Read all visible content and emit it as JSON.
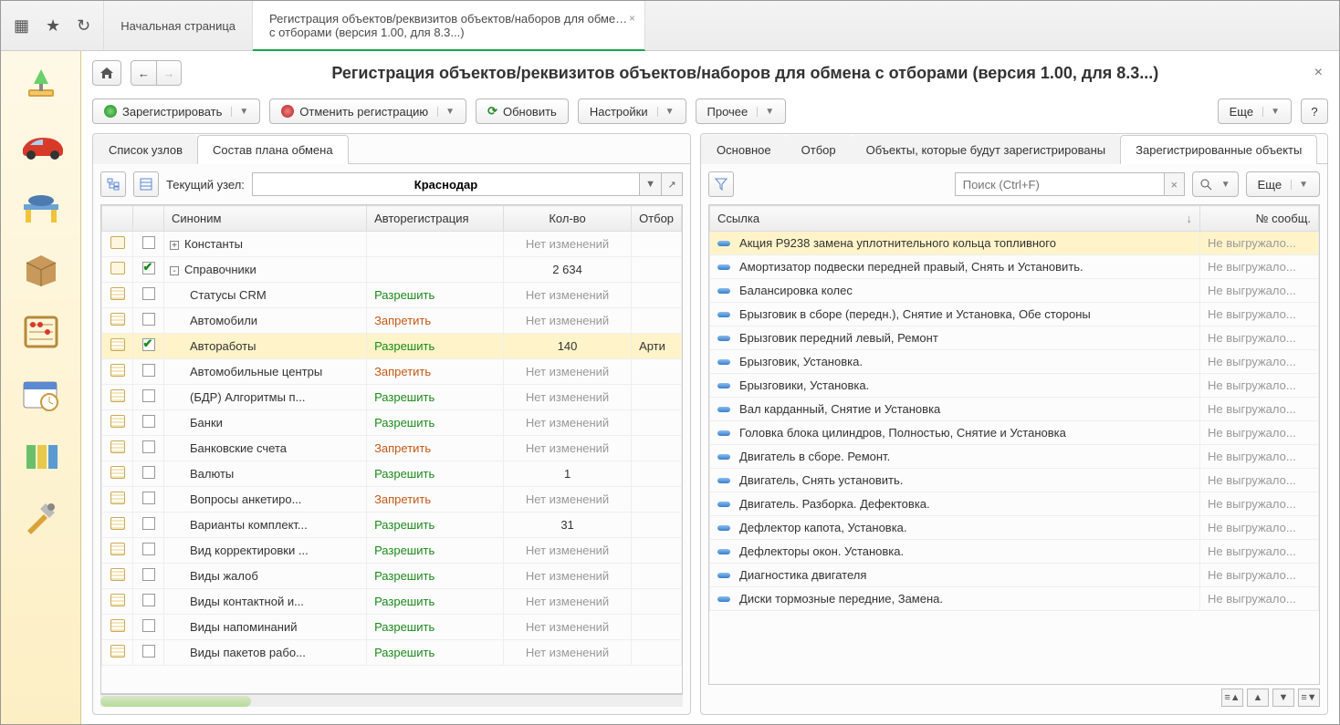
{
  "topbar": {
    "home_tab": "Начальная страница",
    "active_tab_line1": "Регистрация объектов/реквизитов объектов/наборов для обмена",
    "active_tab_line2": "с отборами (версия 1.00, для 8.3...)"
  },
  "header": {
    "title": "Регистрация объектов/реквизитов объектов/наборов для обмена с отборами (версия 1.00, для 8.3...)"
  },
  "toolbar": {
    "register": "Зарегистрировать",
    "unregister": "Отменить регистрацию",
    "refresh": "Обновить",
    "settings": "Настройки",
    "other": "Прочее",
    "more": "Еще",
    "help": "?"
  },
  "left": {
    "tabs": [
      "Список узлов",
      "Состав плана обмена"
    ],
    "active_tab": 1,
    "current_node_label": "Текущий узел:",
    "current_node_value": "Краснодар",
    "columns": {
      "synonym": "Синоним",
      "autoreg": "Авторегистрация",
      "count": "Кол-во",
      "filter": "Отбор"
    },
    "rows": [
      {
        "kind": "group",
        "checked": false,
        "toggle": "+",
        "name": "Константы",
        "auto": "",
        "count": "Нет изменений",
        "count_muted": true
      },
      {
        "kind": "group",
        "checked": true,
        "toggle": "-",
        "name": "Справочники",
        "auto": "",
        "count": "2 634"
      },
      {
        "kind": "item",
        "checked": false,
        "indent": 1,
        "name": "Статусы CRM",
        "auto": "Разрешить",
        "count": "Нет изменений",
        "count_muted": true
      },
      {
        "kind": "item",
        "checked": false,
        "indent": 1,
        "name": "Автомобили",
        "auto": "Запретить",
        "count": "Нет изменений",
        "count_muted": true
      },
      {
        "kind": "item",
        "checked": true,
        "indent": 1,
        "name": "Автоработы",
        "auto": "Разрешить",
        "count": "140",
        "filter": "Арти",
        "selected": true
      },
      {
        "kind": "item",
        "checked": false,
        "indent": 1,
        "name": "Автомобильные центры",
        "auto": "Запретить",
        "count": "Нет изменений",
        "count_muted": true
      },
      {
        "kind": "item",
        "checked": false,
        "indent": 1,
        "name": "(БДР) Алгоритмы п...",
        "auto": "Разрешить",
        "count": "Нет изменений",
        "count_muted": true
      },
      {
        "kind": "item",
        "checked": false,
        "indent": 1,
        "name": "Банки",
        "auto": "Разрешить",
        "count": "Нет изменений",
        "count_muted": true
      },
      {
        "kind": "item",
        "checked": false,
        "indent": 1,
        "name": "Банковские счета",
        "auto": "Запретить",
        "count": "Нет изменений",
        "count_muted": true
      },
      {
        "kind": "item",
        "checked": false,
        "indent": 1,
        "name": "Валюты",
        "auto": "Разрешить",
        "count": "1"
      },
      {
        "kind": "item",
        "checked": false,
        "indent": 1,
        "name": "Вопросы анкетиро...",
        "auto": "Запретить",
        "count": "Нет изменений",
        "count_muted": true
      },
      {
        "kind": "item",
        "checked": false,
        "indent": 1,
        "name": "Варианты комплект...",
        "auto": "Разрешить",
        "count": "31"
      },
      {
        "kind": "item",
        "checked": false,
        "indent": 1,
        "name": "Вид корректировки ...",
        "auto": "Разрешить",
        "count": "Нет изменений",
        "count_muted": true
      },
      {
        "kind": "item",
        "checked": false,
        "indent": 1,
        "name": "Виды жалоб",
        "auto": "Разрешить",
        "count": "Нет изменений",
        "count_muted": true
      },
      {
        "kind": "item",
        "checked": false,
        "indent": 1,
        "name": "Виды контактной и...",
        "auto": "Разрешить",
        "count": "Нет изменений",
        "count_muted": true
      },
      {
        "kind": "item",
        "checked": false,
        "indent": 1,
        "name": "Виды напоминаний",
        "auto": "Разрешить",
        "count": "Нет изменений",
        "count_muted": true
      },
      {
        "kind": "item",
        "checked": false,
        "indent": 1,
        "name": "Виды пакетов рабо...",
        "auto": "Разрешить",
        "count": "Нет изменений",
        "count_muted": true
      }
    ]
  },
  "right": {
    "tabs": [
      "Основное",
      "Отбор",
      "Объекты, которые будут зарегистрированы",
      "Зарегистрированные объекты"
    ],
    "active_tab": 3,
    "search_placeholder": "Поиск (Ctrl+F)",
    "more": "Еще",
    "columns": {
      "link": "Ссылка",
      "msg": "№ сообщ."
    },
    "rows": [
      {
        "t": "Акция Р9238  замена уплотнительного кольца топливного",
        "m": "Не выгружало...",
        "selected": true
      },
      {
        "t": "Амортизатор подвески передней правый, Снять и Установить.",
        "m": "Не выгружало..."
      },
      {
        "t": "Балансировка колес",
        "m": "Не выгружало..."
      },
      {
        "t": "Брызговик в сборе (передн.), Снятие и Установка, Обе стороны",
        "m": "Не выгружало..."
      },
      {
        "t": "Брызговик передний левый, Ремонт",
        "m": "Не выгружало..."
      },
      {
        "t": "Брызговик, Установка.",
        "m": "Не выгружало..."
      },
      {
        "t": "Брызговики, Установка.",
        "m": "Не выгружало..."
      },
      {
        "t": "Вал карданный, Снятие и Установка",
        "m": "Не выгружало..."
      },
      {
        "t": "Головка блока цилиндров, Полностью, Снятие и Установка",
        "m": "Не выгружало..."
      },
      {
        "t": "Двигатель в сборе. Ремонт.",
        "m": "Не выгружало..."
      },
      {
        "t": "Двигатель, Снять установить.",
        "m": "Не выгружало..."
      },
      {
        "t": "Двигатель. Разборка. Дефектовка.",
        "m": "Не выгружало..."
      },
      {
        "t": "Дефлектор капота, Установка.",
        "m": "Не выгружало..."
      },
      {
        "t": "Дефлекторы окон. Установка.",
        "m": "Не выгружало..."
      },
      {
        "t": "Диагностика двигателя",
        "m": "Не выгружало..."
      },
      {
        "t": "Диски тормозные передние, Замена.",
        "m": "Не выгружало..."
      }
    ]
  }
}
